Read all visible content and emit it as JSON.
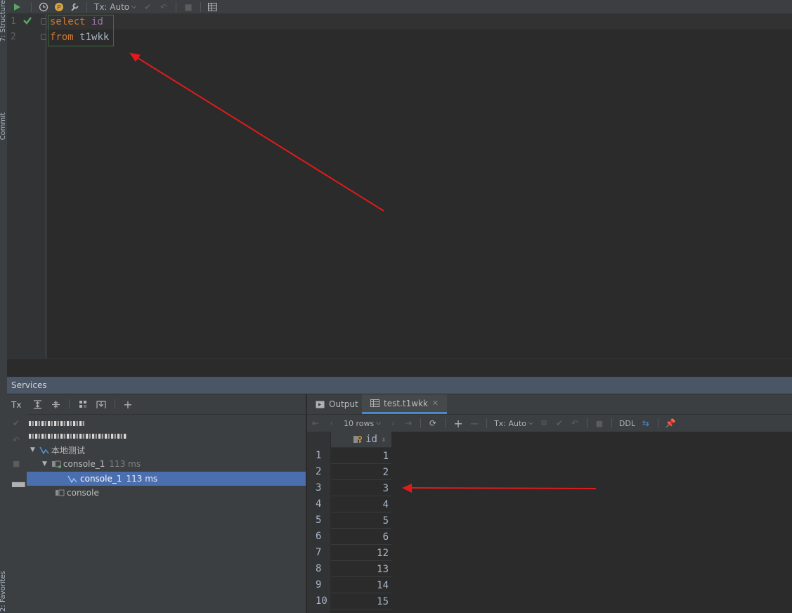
{
  "side_panels": {
    "structure": "7: Structure",
    "commit": "Commit",
    "favorites": "2: Favorites"
  },
  "toolbar": {
    "tx_mode": "Tx: Auto"
  },
  "editor": {
    "line_numbers": [
      "1",
      "2"
    ],
    "line1": {
      "keyword": "select",
      "identifier": "id"
    },
    "line2": {
      "keyword": "from",
      "table": "t1wkk"
    }
  },
  "services": {
    "title": "Services",
    "tx_label": "Tx",
    "tree": {
      "item_local": "本地测试",
      "console_group": "console_1",
      "console_group_time": "113 ms",
      "console_session": "console_1",
      "console_session_time": "113 ms",
      "console_plain": "console"
    }
  },
  "results": {
    "tabs": {
      "output": "Output",
      "table": "test.t1wkk"
    },
    "toolbar": {
      "rows": "10 rows",
      "tx_mode": "Tx: Auto",
      "ddl": "DDL"
    },
    "column": "id",
    "row_numbers": [
      "1",
      "2",
      "3",
      "4",
      "5",
      "6",
      "7",
      "8",
      "9",
      "10"
    ],
    "ids": [
      "1",
      "2",
      "3",
      "4",
      "5",
      "6",
      "12",
      "13",
      "14",
      "15"
    ]
  },
  "colors": {
    "annotation_arrow": "#e01b1b",
    "selection": "#4b6eaf",
    "keyword": "#cc7832",
    "identifier": "#9876aa"
  }
}
